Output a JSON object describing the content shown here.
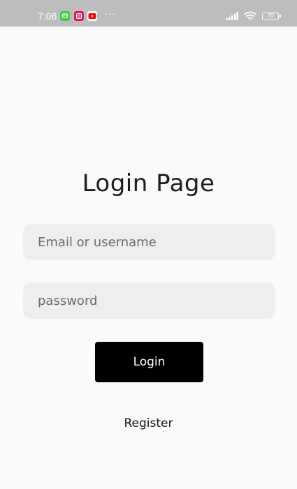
{
  "status_bar": {
    "time": "7:06",
    "more": "···",
    "battery_level": "70",
    "icons": [
      "messaging-app-icon",
      "camera-app-icon",
      "youtube-icon",
      "signal-icon",
      "wifi-icon",
      "battery-icon"
    ],
    "colors": {
      "background": "#bdbdbd",
      "app_green": "#3ecf4a",
      "app_pink": "#d81b60",
      "youtube_red": "#ff0000"
    }
  },
  "login": {
    "title": "Login Page",
    "email_placeholder": "Email or username",
    "password_placeholder": "password",
    "login_button": "Login",
    "register_link": "Register"
  }
}
